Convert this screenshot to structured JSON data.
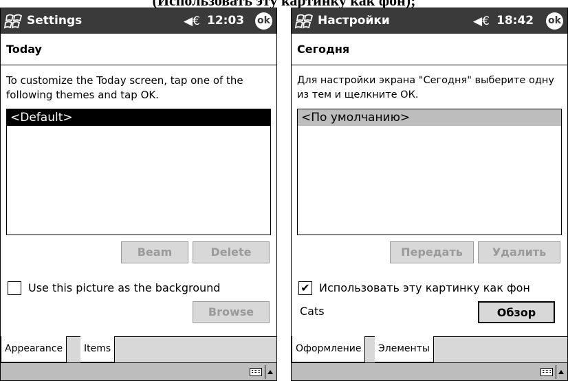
{
  "caption": "(Использовать эту картинку как фон);",
  "left": {
    "title": "Settings",
    "time": "12:03",
    "ok": "ok",
    "section": "Today",
    "instructions": "To customize the Today screen, tap one of the following themes and tap OK.",
    "themes": [
      "<Default>"
    ],
    "beam": "Beam",
    "delete": "Delete",
    "checkbox_label": "Use this picture as the background",
    "checkbox_checked": false,
    "browse": "Browse",
    "tabs": [
      "Appearance",
      "Items"
    ]
  },
  "right": {
    "title": "Настройки",
    "time": "18:42",
    "ok": "ok",
    "section": "Сегодня",
    "instructions": "Для настройки экрана \"Сегодня\" выберите одну из тем и щелкните ОК.",
    "themes": [
      "<По умолчанию>"
    ],
    "beam": "Передать",
    "delete": "Удалить",
    "checkbox_label": "Использовать эту картинку как фон",
    "checkbox_checked": true,
    "check_mark": "✔",
    "picture_name": "Cats",
    "browse": "Обзор",
    "tabs": [
      "Оформление",
      "Элементы"
    ]
  },
  "icons": {
    "start": "windows-flag-icon",
    "volume": "speaker-icon",
    "volume_glyph": "◀€",
    "keyboard": "keyboard-icon",
    "sip_arrow": "arrow-up-icon"
  },
  "colors": {
    "titlebar": "#3a3a3a",
    "selection_black": "#000000",
    "selection_grey": "#bdbdbd",
    "button_face": "#d8d8d8",
    "disabled_text": "#9a9a9a"
  }
}
